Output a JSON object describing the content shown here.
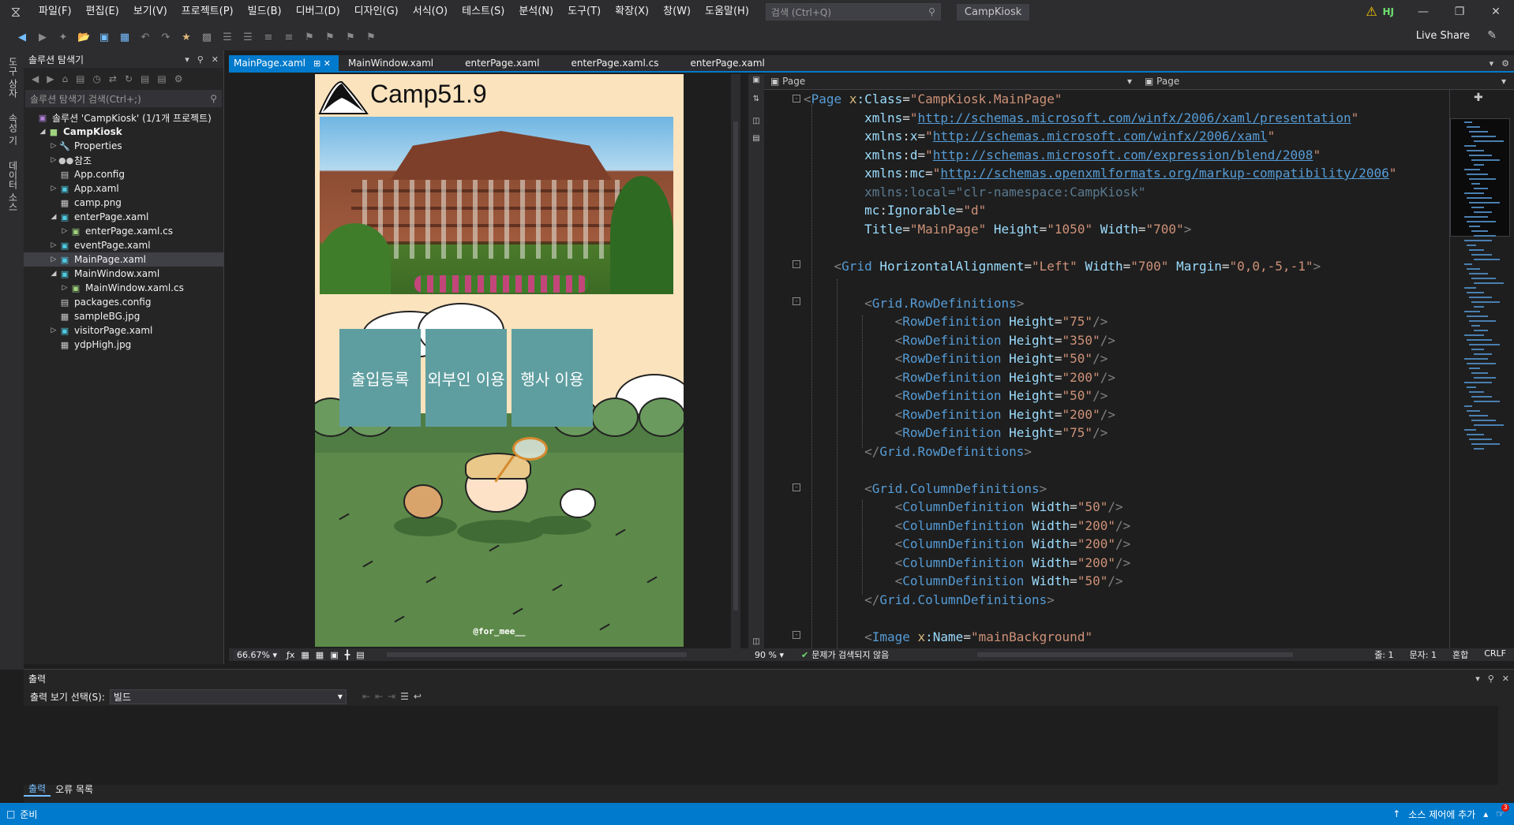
{
  "menu": {
    "items": [
      "파일(F)",
      "편집(E)",
      "보기(V)",
      "프로젝트(P)",
      "빌드(B)",
      "디버그(D)",
      "디자인(G)",
      "서식(O)",
      "테스트(S)",
      "분석(N)",
      "도구(T)",
      "확장(X)",
      "창(W)",
      "도움말(H)"
    ],
    "search_placeholder": "검색 (Ctrl+Q)",
    "project_name": "CampKiosk",
    "user_initials": "HJ"
  },
  "toolbar": {
    "live_share": "Live Share"
  },
  "left_strip": {
    "labels": [
      "도구 상자",
      "속성 기",
      "데이터 소스"
    ]
  },
  "solution_explorer": {
    "title": "솔루션 탐색기",
    "search_placeholder": "솔루션 탐색기 검색(Ctrl+;)",
    "items": [
      {
        "label": "솔루션 'CampKiosk' (1/1개 프로젝트)",
        "level": 0,
        "arrow": "",
        "icon": "solution-icon"
      },
      {
        "label": "CampKiosk",
        "level": 1,
        "arrow": "▲",
        "icon": "project-icon",
        "bold": true
      },
      {
        "label": "Properties",
        "level": 2,
        "arrow": "▶",
        "icon": "wrench-icon"
      },
      {
        "label": "참조",
        "level": 2,
        "arrow": "▶",
        "icon": "references-icon"
      },
      {
        "label": "App.config",
        "level": 2,
        "arrow": "",
        "icon": "config-file-icon"
      },
      {
        "label": "App.xaml",
        "level": 2,
        "arrow": "▶",
        "icon": "xaml-file-icon"
      },
      {
        "label": "camp.png",
        "level": 2,
        "arrow": "",
        "icon": "image-file-icon"
      },
      {
        "label": "enterPage.xaml",
        "level": 2,
        "arrow": "▲",
        "icon": "xaml-file-icon"
      },
      {
        "label": "enterPage.xaml.cs",
        "level": 3,
        "arrow": "▶",
        "icon": "cs-file-icon"
      },
      {
        "label": "eventPage.xaml",
        "level": 2,
        "arrow": "▶",
        "icon": "xaml-file-icon"
      },
      {
        "label": "MainPage.xaml",
        "level": 2,
        "arrow": "▶",
        "icon": "xaml-file-icon",
        "selected": true
      },
      {
        "label": "MainWindow.xaml",
        "level": 2,
        "arrow": "▲",
        "icon": "xaml-file-icon"
      },
      {
        "label": "MainWindow.xaml.cs",
        "level": 3,
        "arrow": "▶",
        "icon": "cs-file-icon"
      },
      {
        "label": "packages.config",
        "level": 2,
        "arrow": "",
        "icon": "config-file-icon"
      },
      {
        "label": "sampleBG.jpg",
        "level": 2,
        "arrow": "",
        "icon": "image-file-icon"
      },
      {
        "label": "visitorPage.xaml",
        "level": 2,
        "arrow": "▶",
        "icon": "xaml-file-icon"
      },
      {
        "label": "ydpHigh.jpg",
        "level": 2,
        "arrow": "",
        "icon": "image-file-icon"
      }
    ]
  },
  "tabs": [
    {
      "label": "MainPage.xaml",
      "active": true
    },
    {
      "label": "MainWindow.xaml"
    },
    {
      "label": "enterPage.xaml"
    },
    {
      "label": "enterPage.xaml.cs"
    },
    {
      "label": "enterPage.xaml"
    }
  ],
  "designer": {
    "kiosk_title": "Camp51.9",
    "buttons": [
      "출입등록",
      "외부인 이용",
      "행사 이용"
    ],
    "watermark": "@for_mee__",
    "zoom": "66.67%"
  },
  "editor": {
    "nav_left": "Page",
    "nav_right": "Page",
    "zoom": "90 %",
    "status_message": "문제가 검색되지 않음",
    "line_label": "줄: 1",
    "char_label": "문자: 1",
    "mode_label": "혼합",
    "eol_label": "CRLF"
  },
  "xaml_lines": [
    [
      [
        "t-p",
        "<"
      ],
      [
        "t-e",
        "Page "
      ],
      [
        "t-n",
        "x"
      ],
      [
        "t-a",
        ":Class"
      ],
      [
        "t-w",
        "="
      ],
      [
        "t-v",
        "\"CampKiosk.MainPage\""
      ]
    ],
    [
      [
        "t-w",
        "        "
      ],
      [
        "t-a",
        "xmlns"
      ],
      [
        "t-w",
        "="
      ],
      [
        "t-v",
        "\""
      ],
      [
        "t-l",
        "http://schemas.microsoft.com/winfx/2006/xaml/presentation"
      ],
      [
        "t-v",
        "\""
      ]
    ],
    [
      [
        "t-w",
        "        "
      ],
      [
        "t-a",
        "xmlns"
      ],
      [
        "t-w",
        ":"
      ],
      [
        "t-a",
        "x"
      ],
      [
        "t-w",
        "="
      ],
      [
        "t-v",
        "\""
      ],
      [
        "t-l",
        "http://schemas.microsoft.com/winfx/2006/xaml"
      ],
      [
        "t-v",
        "\""
      ]
    ],
    [
      [
        "t-w",
        "        "
      ],
      [
        "t-a",
        "xmlns"
      ],
      [
        "t-w",
        ":"
      ],
      [
        "t-a",
        "d"
      ],
      [
        "t-w",
        "="
      ],
      [
        "t-v",
        "\""
      ],
      [
        "t-l",
        "http://schemas.microsoft.com/expression/blend/2008"
      ],
      [
        "t-v",
        "\""
      ]
    ],
    [
      [
        "t-w",
        "        "
      ],
      [
        "t-a",
        "xmlns"
      ],
      [
        "t-w",
        ":"
      ],
      [
        "t-a",
        "mc"
      ],
      [
        "t-w",
        "="
      ],
      [
        "t-v",
        "\""
      ],
      [
        "t-l",
        "http://schemas.openxmlformats.org/markup-compatibility/2006"
      ],
      [
        "t-v",
        "\""
      ]
    ],
    [
      [
        "t-w",
        "        "
      ],
      [
        "t-dim",
        "xmlns:local=\"clr-namespace:CampKiosk\""
      ]
    ],
    [
      [
        "t-w",
        "        "
      ],
      [
        "t-a",
        "mc"
      ],
      [
        "t-w",
        ":"
      ],
      [
        "t-a",
        "Ignorable"
      ],
      [
        "t-w",
        "="
      ],
      [
        "t-v",
        "\"d\""
      ]
    ],
    [
      [
        "t-w",
        "        "
      ],
      [
        "t-a",
        "Title"
      ],
      [
        "t-w",
        "="
      ],
      [
        "t-v",
        "\"MainPage\" "
      ],
      [
        "t-a",
        "Height"
      ],
      [
        "t-w",
        "="
      ],
      [
        "t-v",
        "\"1050\" "
      ],
      [
        "t-a",
        "Width"
      ],
      [
        "t-w",
        "="
      ],
      [
        "t-v",
        "\"700\""
      ],
      [
        "t-p",
        ">"
      ]
    ],
    [],
    [
      [
        "t-w",
        "    "
      ],
      [
        "t-p",
        "<"
      ],
      [
        "t-e",
        "Grid "
      ],
      [
        "t-a",
        "HorizontalAlignment"
      ],
      [
        "t-w",
        "="
      ],
      [
        "t-v",
        "\"Left\" "
      ],
      [
        "t-a",
        "Width"
      ],
      [
        "t-w",
        "="
      ],
      [
        "t-v",
        "\"700\" "
      ],
      [
        "t-a",
        "Margin"
      ],
      [
        "t-w",
        "="
      ],
      [
        "t-v",
        "\"0,0,-5,-1\""
      ],
      [
        "t-p",
        ">"
      ]
    ],
    [],
    [
      [
        "t-w",
        "        "
      ],
      [
        "t-p",
        "<"
      ],
      [
        "t-e",
        "Grid.RowDefinitions"
      ],
      [
        "t-p",
        ">"
      ]
    ],
    [
      [
        "t-w",
        "            "
      ],
      [
        "t-p",
        "<"
      ],
      [
        "t-e",
        "RowDefinition "
      ],
      [
        "t-a",
        "Height"
      ],
      [
        "t-w",
        "="
      ],
      [
        "t-v",
        "\"75\""
      ],
      [
        "t-p",
        "/>"
      ]
    ],
    [
      [
        "t-w",
        "            "
      ],
      [
        "t-p",
        "<"
      ],
      [
        "t-e",
        "RowDefinition "
      ],
      [
        "t-a",
        "Height"
      ],
      [
        "t-w",
        "="
      ],
      [
        "t-v",
        "\"350\""
      ],
      [
        "t-p",
        "/>"
      ]
    ],
    [
      [
        "t-w",
        "            "
      ],
      [
        "t-p",
        "<"
      ],
      [
        "t-e",
        "RowDefinition "
      ],
      [
        "t-a",
        "Height"
      ],
      [
        "t-w",
        "="
      ],
      [
        "t-v",
        "\"50\""
      ],
      [
        "t-p",
        "/>"
      ]
    ],
    [
      [
        "t-w",
        "            "
      ],
      [
        "t-p",
        "<"
      ],
      [
        "t-e",
        "RowDefinition "
      ],
      [
        "t-a",
        "Height"
      ],
      [
        "t-w",
        "="
      ],
      [
        "t-v",
        "\"200\""
      ],
      [
        "t-p",
        "/>"
      ]
    ],
    [
      [
        "t-w",
        "            "
      ],
      [
        "t-p",
        "<"
      ],
      [
        "t-e",
        "RowDefinition "
      ],
      [
        "t-a",
        "Height"
      ],
      [
        "t-w",
        "="
      ],
      [
        "t-v",
        "\"50\""
      ],
      [
        "t-p",
        "/>"
      ]
    ],
    [
      [
        "t-w",
        "            "
      ],
      [
        "t-p",
        "<"
      ],
      [
        "t-e",
        "RowDefinition "
      ],
      [
        "t-a",
        "Height"
      ],
      [
        "t-w",
        "="
      ],
      [
        "t-v",
        "\"200\""
      ],
      [
        "t-p",
        "/>"
      ]
    ],
    [
      [
        "t-w",
        "            "
      ],
      [
        "t-p",
        "<"
      ],
      [
        "t-e",
        "RowDefinition "
      ],
      [
        "t-a",
        "Height"
      ],
      [
        "t-w",
        "="
      ],
      [
        "t-v",
        "\"75\""
      ],
      [
        "t-p",
        "/>"
      ]
    ],
    [
      [
        "t-w",
        "        "
      ],
      [
        "t-p",
        "</"
      ],
      [
        "t-e",
        "Grid.RowDefinitions"
      ],
      [
        "t-p",
        ">"
      ]
    ],
    [],
    [
      [
        "t-w",
        "        "
      ],
      [
        "t-p",
        "<"
      ],
      [
        "t-e",
        "Grid.ColumnDefinitions"
      ],
      [
        "t-p",
        ">"
      ]
    ],
    [
      [
        "t-w",
        "            "
      ],
      [
        "t-p",
        "<"
      ],
      [
        "t-e",
        "ColumnDefinition "
      ],
      [
        "t-a",
        "Width"
      ],
      [
        "t-w",
        "="
      ],
      [
        "t-v",
        "\"50\""
      ],
      [
        "t-p",
        "/>"
      ]
    ],
    [
      [
        "t-w",
        "            "
      ],
      [
        "t-p",
        "<"
      ],
      [
        "t-e",
        "ColumnDefinition "
      ],
      [
        "t-a",
        "Width"
      ],
      [
        "t-w",
        "="
      ],
      [
        "t-v",
        "\"200\""
      ],
      [
        "t-p",
        "/>"
      ]
    ],
    [
      [
        "t-w",
        "            "
      ],
      [
        "t-p",
        "<"
      ],
      [
        "t-e",
        "ColumnDefinition "
      ],
      [
        "t-a",
        "Width"
      ],
      [
        "t-w",
        "="
      ],
      [
        "t-v",
        "\"200\""
      ],
      [
        "t-p",
        "/>"
      ]
    ],
    [
      [
        "t-w",
        "            "
      ],
      [
        "t-p",
        "<"
      ],
      [
        "t-e",
        "ColumnDefinition "
      ],
      [
        "t-a",
        "Width"
      ],
      [
        "t-w",
        "="
      ],
      [
        "t-v",
        "\"200\""
      ],
      [
        "t-p",
        "/>"
      ]
    ],
    [
      [
        "t-w",
        "            "
      ],
      [
        "t-p",
        "<"
      ],
      [
        "t-e",
        "ColumnDefinition "
      ],
      [
        "t-a",
        "Width"
      ],
      [
        "t-w",
        "="
      ],
      [
        "t-v",
        "\"50\""
      ],
      [
        "t-p",
        "/>"
      ]
    ],
    [
      [
        "t-w",
        "        "
      ],
      [
        "t-p",
        "</"
      ],
      [
        "t-e",
        "Grid.ColumnDefinitions"
      ],
      [
        "t-p",
        ">"
      ]
    ],
    [],
    [
      [
        "t-w",
        "        "
      ],
      [
        "t-p",
        "<"
      ],
      [
        "t-e",
        "Image "
      ],
      [
        "t-n",
        "x"
      ],
      [
        "t-a",
        ":Name"
      ],
      [
        "t-w",
        "="
      ],
      [
        "t-v",
        "\"mainBackground\""
      ]
    ]
  ],
  "output": {
    "title": "출력",
    "select_label": "출력 보기 선택(S):",
    "select_value": "빌드",
    "tabs": [
      "출력",
      "오류 목록"
    ]
  },
  "statusbar": {
    "left": "준비",
    "source_control": "소스 제어에 추가",
    "notification_count": "3"
  },
  "colors": {
    "accent": "#007acc",
    "kiosk_button": "#5f9ea0",
    "kiosk_bg": "#fbe3be"
  }
}
